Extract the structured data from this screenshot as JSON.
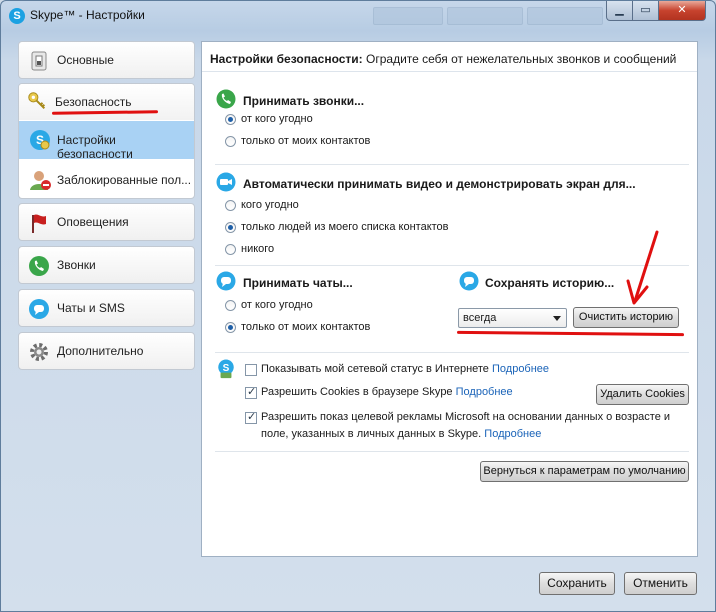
{
  "window": {
    "title": "Skype™ - Настройки",
    "icon": "skype-icon"
  },
  "sidebar": {
    "items": [
      {
        "label": "Основные",
        "icon": "general-switch-icon"
      },
      {
        "label": "Безопасность",
        "icon": "keys-icon",
        "children": [
          {
            "label": "Настройки безопасности",
            "icon": "security-settings-icon",
            "selected": true
          },
          {
            "label": "Заблокированные пол...",
            "icon": "blocked-users-icon"
          }
        ]
      },
      {
        "label": "Оповещения",
        "icon": "red-flag-icon"
      },
      {
        "label": "Звонки",
        "icon": "phone-icon"
      },
      {
        "label": "Чаты и SMS",
        "icon": "chat-icon"
      },
      {
        "label": "Дополнительно",
        "icon": "gear-icon"
      }
    ]
  },
  "main": {
    "header_bold": "Настройки безопасности:",
    "header_rest": " Оградите себя от нежелательных звонков и сообщений",
    "calls": {
      "title": "Принимать звонки...",
      "options": [
        "от кого угодно",
        "только от моих контактов"
      ],
      "selected": 0
    },
    "video": {
      "title": "Автоматически принимать видео и демонстрировать экран для...",
      "options": [
        "кого угодно",
        "только людей из моего списка контактов",
        "никого"
      ],
      "selected": 1
    },
    "chats": {
      "title": "Принимать чаты...",
      "options": [
        "от кого угодно",
        "только от моих контактов"
      ],
      "selected": 1
    },
    "history": {
      "title": "Сохранять историю...",
      "value": "всегда",
      "clear_button": "Очистить историю"
    },
    "privacy": {
      "online_status": "Показывать мой сетевой статус в Интернете",
      "online_status_checked": false,
      "cookies": "Разрешить Cookies в браузере Skype",
      "cookies_checked": true,
      "delete_cookies": "Удалить Cookies",
      "ads_line1": "Разрешить показ целевой рекламы Microsoft на основании данных о возрасте и",
      "ads_line2": "поле, указанных в личных данных в Skype.",
      "ads_checked": true,
      "more_link": "Подробнее"
    },
    "reset_button": "Вернуться к параметрам по умолчанию"
  },
  "footer": {
    "save": "Сохранить",
    "cancel": "Отменить"
  },
  "colors": {
    "accent": "#1ba1e2",
    "selection": "#a9d2f4",
    "annotation_red": "#e01010",
    "link": "#1a63b8"
  }
}
